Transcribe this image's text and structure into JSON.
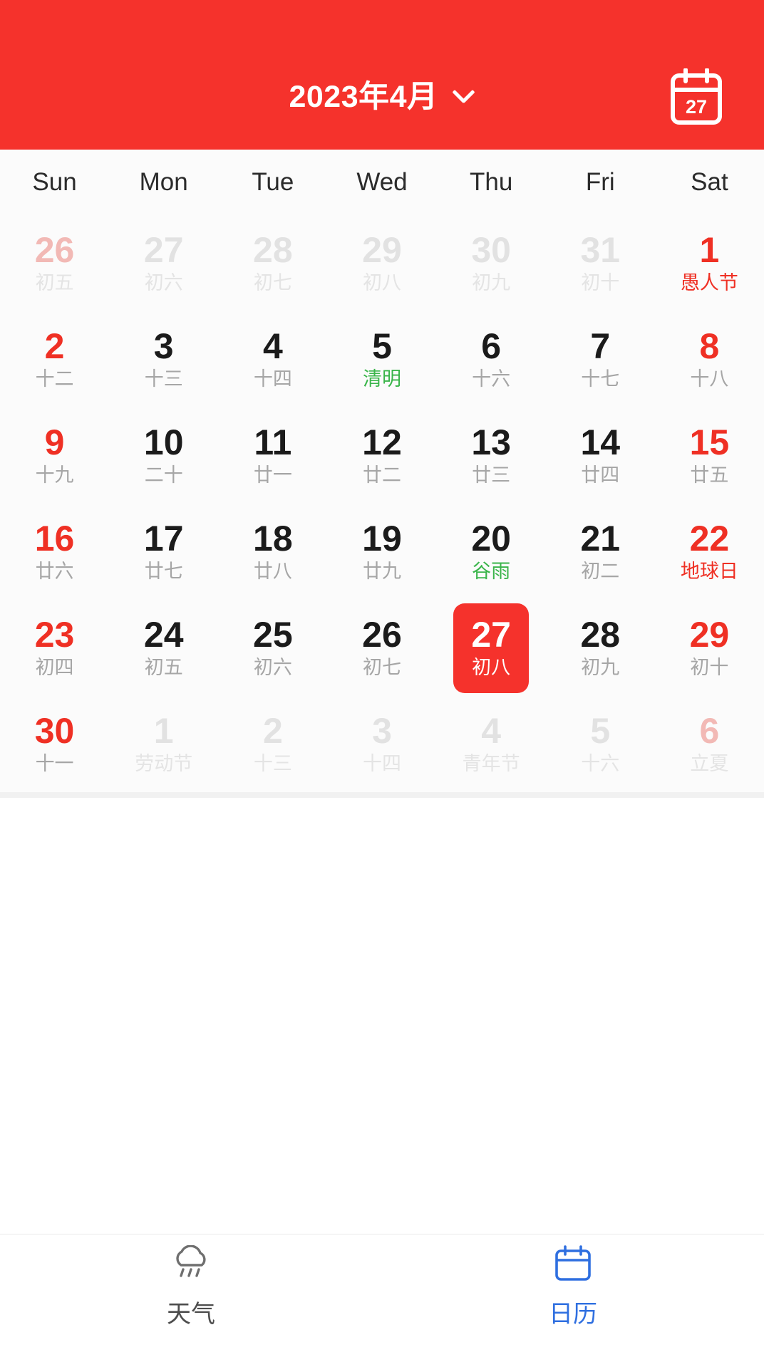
{
  "header": {
    "title": "2023年4月",
    "chevron_icon": "chevron-down-icon",
    "today_button_icon": "calendar-today-icon",
    "today_button_day": "27",
    "background_color": "#f5322c"
  },
  "weekdays": [
    "Sun",
    "Mon",
    "Tue",
    "Wed",
    "Thu",
    "Fri",
    "Sat"
  ],
  "colors": {
    "accent_red": "#f5322c",
    "weekend_red": "#ef3024",
    "solar_term_green": "#3ab54a",
    "muted_gray": "#a6a6a6",
    "other_month_gray": "#e2e2e2",
    "tab_active_blue": "#2f6fe0"
  },
  "calendar": {
    "year": "2023",
    "month": "4",
    "selected_day": "27",
    "selected_lunar": "初八",
    "cells": [
      {
        "num": "26",
        "lunar": "初五",
        "other": true,
        "weekend": true,
        "lunar_style": "",
        "selected": false
      },
      {
        "num": "27",
        "lunar": "初六",
        "other": true,
        "weekend": false,
        "lunar_style": "",
        "selected": false
      },
      {
        "num": "28",
        "lunar": "初七",
        "other": true,
        "weekend": false,
        "lunar_style": "",
        "selected": false
      },
      {
        "num": "29",
        "lunar": "初八",
        "other": true,
        "weekend": false,
        "lunar_style": "",
        "selected": false
      },
      {
        "num": "30",
        "lunar": "初九",
        "other": true,
        "weekend": false,
        "lunar_style": "",
        "selected": false
      },
      {
        "num": "31",
        "lunar": "初十",
        "other": true,
        "weekend": false,
        "lunar_style": "",
        "selected": false
      },
      {
        "num": "1",
        "lunar": "愚人节",
        "other": false,
        "weekend": true,
        "lunar_style": "red",
        "selected": false
      },
      {
        "num": "2",
        "lunar": "十二",
        "other": false,
        "weekend": true,
        "lunar_style": "",
        "selected": false
      },
      {
        "num": "3",
        "lunar": "十三",
        "other": false,
        "weekend": false,
        "lunar_style": "",
        "selected": false
      },
      {
        "num": "4",
        "lunar": "十四",
        "other": false,
        "weekend": false,
        "lunar_style": "",
        "selected": false
      },
      {
        "num": "5",
        "lunar": "清明",
        "other": false,
        "weekend": false,
        "lunar_style": "green",
        "selected": false
      },
      {
        "num": "6",
        "lunar": "十六",
        "other": false,
        "weekend": false,
        "lunar_style": "",
        "selected": false
      },
      {
        "num": "7",
        "lunar": "十七",
        "other": false,
        "weekend": false,
        "lunar_style": "",
        "selected": false
      },
      {
        "num": "8",
        "lunar": "十八",
        "other": false,
        "weekend": true,
        "lunar_style": "",
        "selected": false
      },
      {
        "num": "9",
        "lunar": "十九",
        "other": false,
        "weekend": true,
        "lunar_style": "",
        "selected": false
      },
      {
        "num": "10",
        "lunar": "二十",
        "other": false,
        "weekend": false,
        "lunar_style": "",
        "selected": false
      },
      {
        "num": "11",
        "lunar": "廿一",
        "other": false,
        "weekend": false,
        "lunar_style": "",
        "selected": false
      },
      {
        "num": "12",
        "lunar": "廿二",
        "other": false,
        "weekend": false,
        "lunar_style": "",
        "selected": false
      },
      {
        "num": "13",
        "lunar": "廿三",
        "other": false,
        "weekend": false,
        "lunar_style": "",
        "selected": false
      },
      {
        "num": "14",
        "lunar": "廿四",
        "other": false,
        "weekend": false,
        "lunar_style": "",
        "selected": false
      },
      {
        "num": "15",
        "lunar": "廿五",
        "other": false,
        "weekend": true,
        "lunar_style": "",
        "selected": false
      },
      {
        "num": "16",
        "lunar": "廿六",
        "other": false,
        "weekend": true,
        "lunar_style": "",
        "selected": false
      },
      {
        "num": "17",
        "lunar": "廿七",
        "other": false,
        "weekend": false,
        "lunar_style": "",
        "selected": false
      },
      {
        "num": "18",
        "lunar": "廿八",
        "other": false,
        "weekend": false,
        "lunar_style": "",
        "selected": false
      },
      {
        "num": "19",
        "lunar": "廿九",
        "other": false,
        "weekend": false,
        "lunar_style": "",
        "selected": false
      },
      {
        "num": "20",
        "lunar": "谷雨",
        "other": false,
        "weekend": false,
        "lunar_style": "green",
        "selected": false
      },
      {
        "num": "21",
        "lunar": "初二",
        "other": false,
        "weekend": false,
        "lunar_style": "",
        "selected": false
      },
      {
        "num": "22",
        "lunar": "地球日",
        "other": false,
        "weekend": true,
        "lunar_style": "red",
        "selected": false
      },
      {
        "num": "23",
        "lunar": "初四",
        "other": false,
        "weekend": true,
        "lunar_style": "",
        "selected": false
      },
      {
        "num": "24",
        "lunar": "初五",
        "other": false,
        "weekend": false,
        "lunar_style": "",
        "selected": false
      },
      {
        "num": "25",
        "lunar": "初六",
        "other": false,
        "weekend": false,
        "lunar_style": "",
        "selected": false
      },
      {
        "num": "26",
        "lunar": "初七",
        "other": false,
        "weekend": false,
        "lunar_style": "",
        "selected": false
      },
      {
        "num": "27",
        "lunar": "初八",
        "other": false,
        "weekend": false,
        "lunar_style": "",
        "selected": true
      },
      {
        "num": "28",
        "lunar": "初九",
        "other": false,
        "weekend": false,
        "lunar_style": "",
        "selected": false
      },
      {
        "num": "29",
        "lunar": "初十",
        "other": false,
        "weekend": true,
        "lunar_style": "",
        "selected": false
      },
      {
        "num": "30",
        "lunar": "十一",
        "other": false,
        "weekend": true,
        "lunar_style": "",
        "selected": false
      },
      {
        "num": "1",
        "lunar": "劳动节",
        "other": true,
        "weekend": false,
        "lunar_style": "",
        "selected": false
      },
      {
        "num": "2",
        "lunar": "十三",
        "other": true,
        "weekend": false,
        "lunar_style": "",
        "selected": false
      },
      {
        "num": "3",
        "lunar": "十四",
        "other": true,
        "weekend": false,
        "lunar_style": "",
        "selected": false
      },
      {
        "num": "4",
        "lunar": "青年节",
        "other": true,
        "weekend": false,
        "lunar_style": "",
        "selected": false
      },
      {
        "num": "5",
        "lunar": "十六",
        "other": true,
        "weekend": false,
        "lunar_style": "",
        "selected": false
      },
      {
        "num": "6",
        "lunar": "立夏",
        "other": true,
        "weekend": true,
        "lunar_style": "",
        "selected": false
      }
    ]
  },
  "tabbar": {
    "items": [
      {
        "label": "天气",
        "icon": "cloud-rain-icon",
        "active": false
      },
      {
        "label": "日历",
        "icon": "calendar-icon",
        "active": true
      }
    ]
  }
}
